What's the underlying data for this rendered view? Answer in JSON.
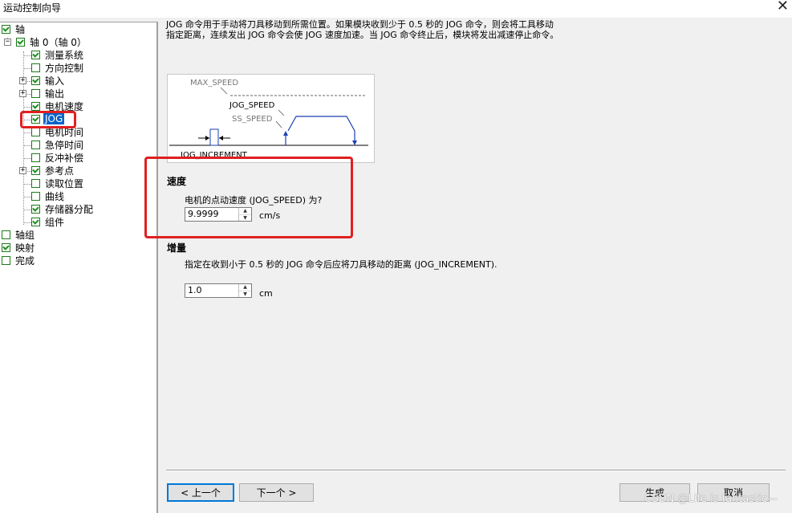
{
  "window": {
    "title": "运动控制向导"
  },
  "tree": {
    "items": [
      {
        "label": "轴",
        "checked": true
      },
      {
        "label": "轴 0（轴 0）",
        "checked": true
      },
      {
        "label": "测量系统",
        "checked": true
      },
      {
        "label": "方向控制",
        "checked": false
      },
      {
        "label": "输入",
        "checked": true
      },
      {
        "label": "输出",
        "checked": false
      },
      {
        "label": "电机速度",
        "checked": true
      },
      {
        "label": "JOG",
        "checked": true
      },
      {
        "label": "电机时间",
        "checked": false
      },
      {
        "label": "急停时间",
        "checked": false
      },
      {
        "label": "反冲补偿",
        "checked": false
      },
      {
        "label": "参考点",
        "checked": true
      },
      {
        "label": "读取位置",
        "checked": false
      },
      {
        "label": "曲线",
        "checked": false
      },
      {
        "label": "存储器分配",
        "checked": true
      },
      {
        "label": "组件",
        "checked": true
      },
      {
        "label": "轴组",
        "checked": false
      },
      {
        "label": "映射",
        "checked": true
      },
      {
        "label": "完成",
        "checked": false
      }
    ]
  },
  "main": {
    "description": "JOG 命令用于手动将刀具移动到所需位置。如果模块收到少于 0.5 秒的 JOG 命令，则会将工具移动指定距离，连续发出 JOG 命令会使 JOG 速度加速。当 JOG 命令终止后，模块将发出减速停止命令。",
    "diagram": {
      "max_speed": "MAX_SPEED",
      "jog_speed": "JOG_SPEED",
      "ss_speed": "SS_SPEED",
      "jog_increment": "JOG_INCREMENT"
    },
    "speed": {
      "title": "速度",
      "label": "电机的点动速度 (JOG_SPEED) 为?",
      "value": "9.9999",
      "unit": "cm/s"
    },
    "increment": {
      "title": "增量",
      "label": "指定在收到小于 0.5 秒的 JOG 命令后应将刀具移动的距离 (JOG_INCREMENT).",
      "value": "1.0",
      "unit": "cm"
    }
  },
  "buttons": {
    "prev": "< 上一个",
    "next": "下一个 >",
    "generate": "生成",
    "cancel": "取消"
  },
  "watermark": "CSDN @Life is fantastic—",
  "colors": {
    "highlight_box": "#e02020",
    "selection": "#0a63c9",
    "checkmark": "#1b8f1b"
  }
}
